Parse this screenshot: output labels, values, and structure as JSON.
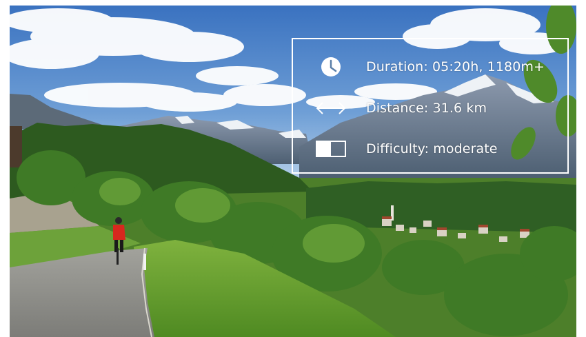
{
  "info": {
    "duration": {
      "icon": "clock-icon",
      "text": "Duration: 05:20h, 1180m+"
    },
    "distance": {
      "icon": "double-arrow-icon",
      "text": "Distance: 31.6 km"
    },
    "difficulty": {
      "icon": "toggle-half-icon",
      "text": "Difficulty: moderate"
    }
  },
  "colors": {
    "sky_top": "#3f78c4",
    "sky_bottom": "#a9c9e8",
    "grass": "#5f9a2c",
    "forest": "#2f5a1e",
    "road": "#8e8e8a",
    "overlay_text": "#ffffff",
    "cyclist_jersey": "#d8281e"
  }
}
